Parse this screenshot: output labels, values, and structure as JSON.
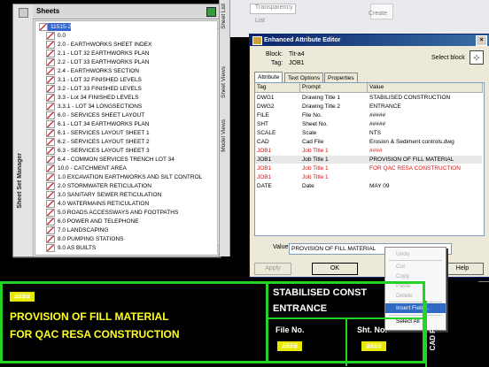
{
  "ribbon": {
    "transparency_label": "Transparency",
    "list_label": "List",
    "create_label": "Create"
  },
  "sheet_set_manager": {
    "side_title": "Sheet Set Manager",
    "header": "Sheets",
    "items": [
      {
        "label": "11515-2",
        "level": 0,
        "selected": true
      },
      {
        "label": "0.0",
        "level": 1
      },
      {
        "label": "2.0 - EARTHWORKS SHEET INDEX",
        "level": 1
      },
      {
        "label": "2.1 - LOT 32 EARTHWORKS PLAN",
        "level": 1
      },
      {
        "label": "2.2 - LOT 33 EARTHWORKS PLAN",
        "level": 1
      },
      {
        "label": "2.4 - EARTHWORKS SECTION",
        "level": 1
      },
      {
        "label": "3.1 - LOT 32 FINISHED LEVELS",
        "level": 1
      },
      {
        "label": "3.2 - LOT 33 FINISHED LEVELS",
        "level": 1
      },
      {
        "label": "3.3 - Lot 34 FINISHED LEVELS",
        "level": 1
      },
      {
        "label": "3.3.1 - LOT 34 LONGSECTIONS",
        "level": 1
      },
      {
        "label": "6.0 - SERVICES SHEET LAYOUT",
        "level": 1
      },
      {
        "label": "6.1 - LOT 34 EARTHWORKS PLAN",
        "level": 1
      },
      {
        "label": "6.1 - SERVICES LAYOUT SHEET 1",
        "level": 1
      },
      {
        "label": "6.2 - SERVICES LAYOUT SHEET 2",
        "level": 1
      },
      {
        "label": "6.3 - SERVICES LAYOUT SHEET 3",
        "level": 1
      },
      {
        "label": "6.4 - COMMON SERVICES TRENCH LOT 34",
        "level": 1
      },
      {
        "label": "10.0 - CATCHMENT AREA",
        "level": 1
      },
      {
        "label": "1.0 EXCAVATION EARTHWORKS AND SILT CONTROL",
        "level": 1
      },
      {
        "label": "2.0 STORMWATER RETICULATION",
        "level": 1
      },
      {
        "label": "3.0 SANITARY SEWER RETICULATION",
        "level": 1
      },
      {
        "label": "4.0 WATERMAINS RETICULATION",
        "level": 1
      },
      {
        "label": "5.0 ROADS ACCESSWAYS AND FOOTPATHS",
        "level": 1
      },
      {
        "label": "6.0 POWER AND TELEPHONE",
        "level": 1
      },
      {
        "label": "7.0 LANDSCAPING",
        "level": 1
      },
      {
        "label": "8.0 PUMPING STATIONS",
        "level": 1
      },
      {
        "label": "9.0 AS BUILTS",
        "level": 1
      }
    ]
  },
  "side_tabs": [
    "Sheet List",
    "Sheet Views",
    "Model Views"
  ],
  "attribute_editor": {
    "title": "Enhanced Attribute Editor",
    "block_label": "Block:",
    "block_value": "Tit-a4",
    "tag_label": "Tag:",
    "tag_value": "JOB1",
    "select_block_label": "Select block",
    "tabs": [
      "Attribute",
      "Text Options",
      "Properties"
    ],
    "columns": [
      "Tag",
      "Prompt",
      "Value"
    ],
    "rows": [
      {
        "tag": "DWG1",
        "prompt": "Drawing Title 1",
        "value": "STABILISED CONSTRUCTION",
        "style": ""
      },
      {
        "tag": "DWG2",
        "prompt": "Drawing Title 2",
        "value": "ENTRANCE",
        "style": ""
      },
      {
        "tag": "FILE",
        "prompt": "File No.",
        "value": "#####",
        "style": ""
      },
      {
        "tag": "SHT",
        "prompt": "Sheet No.",
        "value": "#####",
        "style": ""
      },
      {
        "tag": "SCALE",
        "prompt": "Scale",
        "value": "NTS",
        "style": ""
      },
      {
        "tag": "CAD",
        "prompt": "Cad File",
        "value": "Erosion & Sediment controls.dwg",
        "style": ""
      },
      {
        "tag": "JOB1",
        "prompt": "Job Title 1",
        "value": "####",
        "style": "red"
      },
      {
        "tag": "JOB1",
        "prompt": "Job Title 1",
        "value": "PROVISION OF FILL MATERIAL",
        "style": "sel"
      },
      {
        "tag": "JOB1",
        "prompt": "Job Title 1",
        "value": "FOR QAC RESA CONSTRUCTION",
        "style": "red"
      },
      {
        "tag": "JOB1",
        "prompt": "Job Title 1",
        "value": "",
        "style": "red"
      },
      {
        "tag": "DATE",
        "prompt": "Date",
        "value": "MAY 09",
        "style": ""
      }
    ],
    "value_label": "Value:",
    "value_text": "PROVISION OF FILL MATERIAL",
    "buttons": {
      "apply": "Apply",
      "ok": "OK",
      "help": "Help"
    }
  },
  "context_menu": {
    "items": [
      {
        "label": "Undo",
        "state": "disabled"
      },
      {
        "label": "Cut",
        "state": "disabled"
      },
      {
        "label": "Copy",
        "state": "disabled"
      },
      {
        "label": "Paste",
        "state": "disabled"
      },
      {
        "label": "Delete",
        "state": "disabled"
      },
      {
        "label": "Insert Field...",
        "state": "highlight"
      },
      {
        "label": "Select All",
        "state": "normal"
      }
    ]
  },
  "drawing": {
    "tag_placeholder": "####",
    "line1": "PROVISION OF FILL MATERIAL",
    "line2": "FOR QAC RESA CONSTRUCTION",
    "title1": "STABILISED CONST",
    "title2": "ENTRANCE",
    "file_no_label": "File No.",
    "sht_no_label": "Sht. No.",
    "cad_label": "CAD F"
  },
  "colors": {
    "green_border": "#25d325",
    "yellow_text": "#ffff22",
    "title_bar": "#0a246a"
  }
}
